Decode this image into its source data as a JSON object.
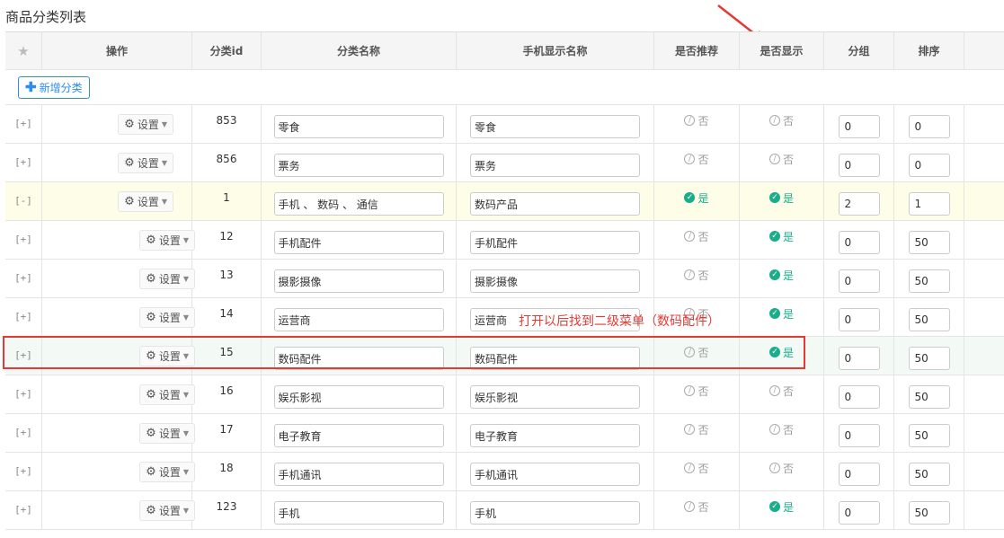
{
  "page": {
    "title": "商品分类列表"
  },
  "header": {
    "star_icon": "star-icon",
    "columns": [
      "操作",
      "分类id",
      "分类名称",
      "手机显示名称",
      "是否推荐",
      "是否显示",
      "分组",
      "排序"
    ]
  },
  "toolbar": {
    "add_label": "新增分类"
  },
  "annotation": {
    "text": "打开以后找到二级菜单（数码配件）"
  },
  "colors": {
    "accent": "#2d8cf0",
    "yes": "#1aad8c",
    "no": "#999999",
    "annotation": "#e53935"
  },
  "rows": [
    {
      "expander": "[+]",
      "action": "设置",
      "id": "853",
      "name": "零食",
      "mobile_name": "零食",
      "recommend": "否",
      "display": "否",
      "group": "0",
      "sort": "0"
    },
    {
      "expander": "[+]",
      "action": "设置",
      "id": "856",
      "name": "票务",
      "mobile_name": "票务",
      "recommend": "否",
      "display": "否",
      "group": "0",
      "sort": "0"
    },
    {
      "expander": "[-]",
      "action": "设置",
      "id": "1",
      "name": "手机 、 数码 、 通信",
      "mobile_name": "数码产品",
      "recommend": "是",
      "display": "是",
      "group": "2",
      "sort": "1"
    },
    {
      "expander": "[+]",
      "action": "设置",
      "id": "12",
      "name": "手机配件",
      "mobile_name": "手机配件",
      "recommend": "否",
      "display": "是",
      "group": "0",
      "sort": "50"
    },
    {
      "expander": "[+]",
      "action": "设置",
      "id": "13",
      "name": "摄影摄像",
      "mobile_name": "摄影摄像",
      "recommend": "否",
      "display": "是",
      "group": "0",
      "sort": "50"
    },
    {
      "expander": "[+]",
      "action": "设置",
      "id": "14",
      "name": "运营商",
      "mobile_name": "运营商",
      "recommend": "否",
      "display": "是",
      "group": "0",
      "sort": "50"
    },
    {
      "expander": "[+]",
      "action": "设置",
      "id": "15",
      "name": "数码配件",
      "mobile_name": "数码配件",
      "recommend": "否",
      "display": "是",
      "group": "0",
      "sort": "50"
    },
    {
      "expander": "[+]",
      "action": "设置",
      "id": "16",
      "name": "娱乐影视",
      "mobile_name": "娱乐影视",
      "recommend": "否",
      "display": "否",
      "group": "0",
      "sort": "50"
    },
    {
      "expander": "[+]",
      "action": "设置",
      "id": "17",
      "name": "电子教育",
      "mobile_name": "电子教育",
      "recommend": "否",
      "display": "否",
      "group": "0",
      "sort": "50"
    },
    {
      "expander": "[+]",
      "action": "设置",
      "id": "18",
      "name": "手机通讯",
      "mobile_name": "手机通讯",
      "recommend": "否",
      "display": "否",
      "group": "0",
      "sort": "50"
    },
    {
      "expander": "[+]",
      "action": "设置",
      "id": "123",
      "name": "手机",
      "mobile_name": "手机",
      "recommend": "否",
      "display": "是",
      "group": "0",
      "sort": "50"
    }
  ]
}
